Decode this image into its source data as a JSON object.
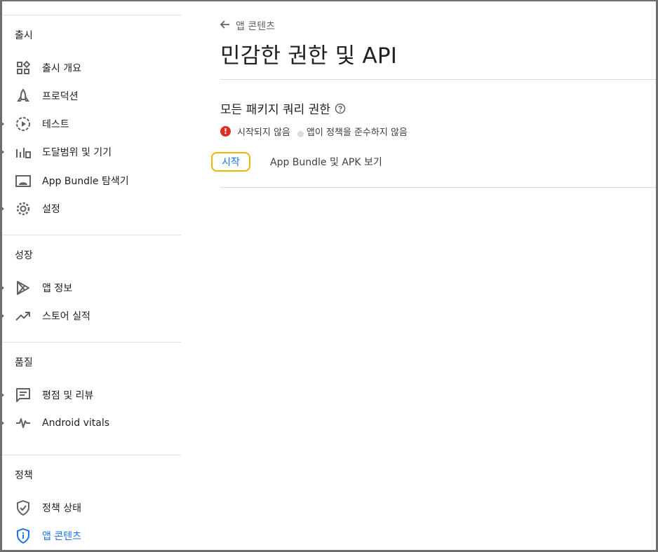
{
  "sidebar": {
    "sections": [
      {
        "title": "출시",
        "items": [
          {
            "label": "출시 개요",
            "icon": "dashboard-icon"
          },
          {
            "label": "프로덕션",
            "icon": "rocket-icon"
          },
          {
            "label": "테스트",
            "icon": "play-circle-icon"
          },
          {
            "label": "도달범위 및 기기",
            "icon": "bar-chart-icon"
          },
          {
            "label": "App Bundle 탐색기",
            "icon": "android-icon"
          },
          {
            "label": "설정",
            "icon": "gear-icon"
          }
        ]
      },
      {
        "title": "성장",
        "items": [
          {
            "label": "앱 정보",
            "icon": "play-store-icon"
          },
          {
            "label": "스토어 실적",
            "icon": "trending-up-icon"
          }
        ]
      },
      {
        "title": "품질",
        "items": [
          {
            "label": "평점 및 리뷰",
            "icon": "review-icon"
          },
          {
            "label": "Android vitals",
            "icon": "vitals-icon"
          }
        ]
      },
      {
        "title": "정책",
        "items": [
          {
            "label": "정책 상태",
            "icon": "shield-check-icon"
          },
          {
            "label": "앱 콘텐츠",
            "icon": "shield-info-icon"
          }
        ]
      }
    ]
  },
  "main": {
    "back_label": "앱 콘텐츠",
    "title": "민감한 권한 및 API",
    "card": {
      "title": "모든 패키지 쿼리 권한",
      "status_not_started": "시작되지 않음",
      "status_policy": "앱이 정책을 준수하지 않음",
      "start_button": "시작",
      "view_link": "App Bundle 및 APK 보기"
    }
  },
  "colors": {
    "accent": "#1a73e8",
    "error": "#d93025",
    "focus": "#f4b400"
  }
}
